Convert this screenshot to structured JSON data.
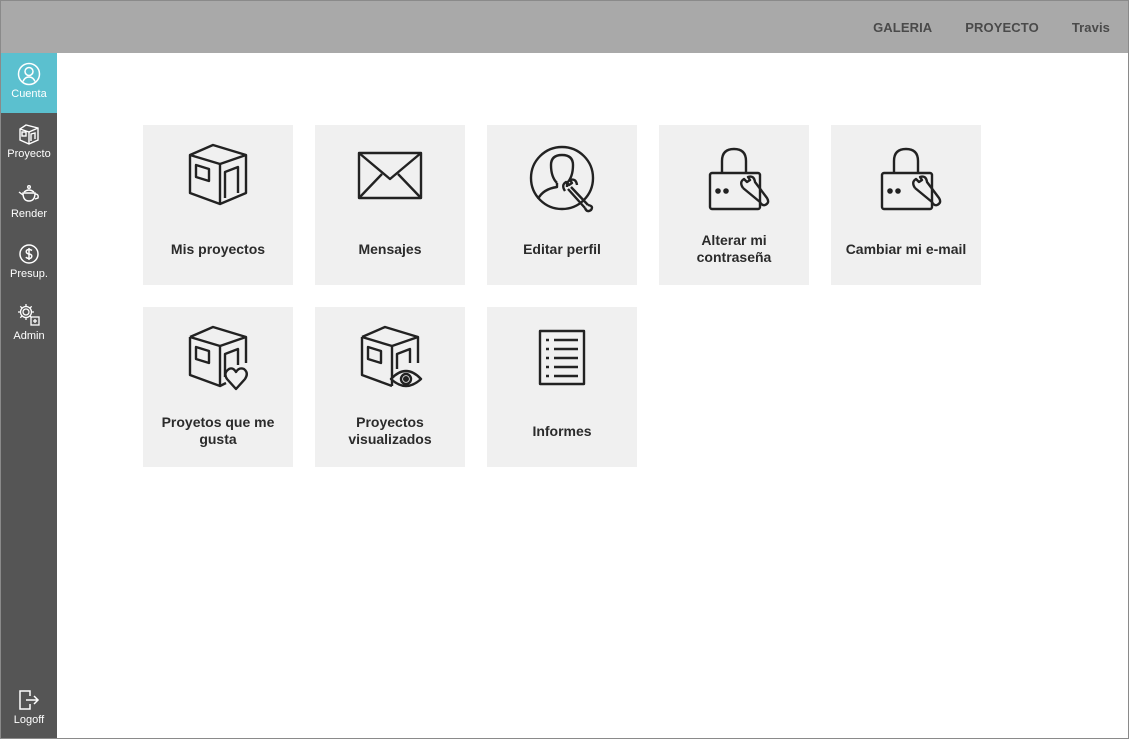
{
  "topnav": {
    "galeria": "GALERIA",
    "proyecto": "PROYECTO",
    "user": "Travis"
  },
  "sidebar": {
    "items": [
      {
        "label": "Cuenta",
        "icon": "user-circle-icon",
        "active": true
      },
      {
        "label": "Proyecto",
        "icon": "room-cube-icon"
      },
      {
        "label": "Render",
        "icon": "teapot-icon"
      },
      {
        "label": "Presup.",
        "icon": "dollar-circle-icon"
      },
      {
        "label": "Admin",
        "icon": "gears-icon"
      }
    ],
    "logoff": {
      "label": "Logoff",
      "icon": "logout-icon"
    }
  },
  "tiles": [
    {
      "label": "Mis proyectos",
      "icon": "room-cube-icon"
    },
    {
      "label": "Mensajes",
      "icon": "envelope-icon"
    },
    {
      "label": "Editar perfil",
      "icon": "user-wrench-icon"
    },
    {
      "label": "Alterar mi contraseña",
      "icon": "lock-wrench-icon"
    },
    {
      "label": "Cambiar mi e-mail",
      "icon": "lock-wrench-icon"
    },
    {
      "label": "Proyetos que me gusta",
      "icon": "room-heart-icon"
    },
    {
      "label": "Proyectos visualizados",
      "icon": "room-eye-icon"
    },
    {
      "label": "Informes",
      "icon": "document-list-icon"
    }
  ],
  "colors": {
    "topbar": "#a9a9a9",
    "sidebar": "#555555",
    "active": "#5bc0cf",
    "tile": "#f0f0f0"
  }
}
